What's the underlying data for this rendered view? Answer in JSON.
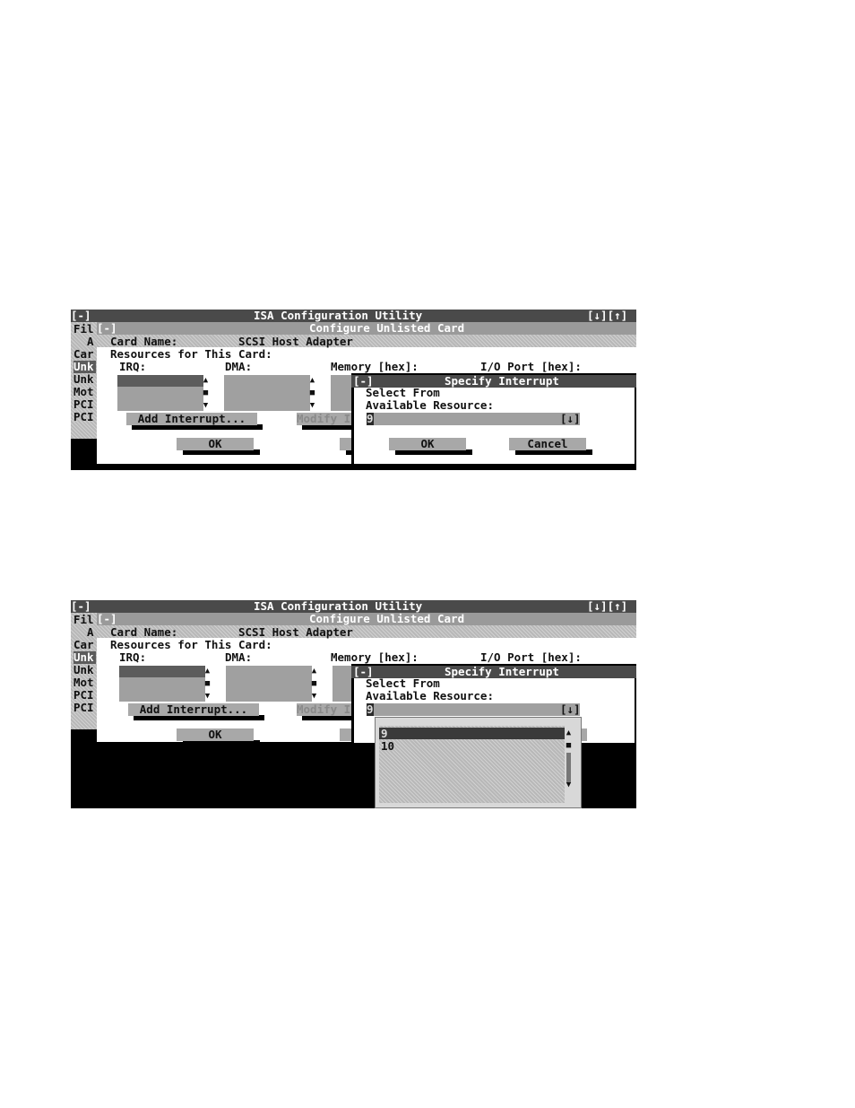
{
  "window": {
    "sys_menu": "[-]",
    "title": "ISA Configuration Utility",
    "controls": "[↓][↑]",
    "menu_stub": "Fil"
  },
  "side_list": {
    "items": [
      "A",
      "Car",
      "Unk",
      "Unk",
      "Mot",
      "PCI",
      "PCI"
    ],
    "selected_index": 2
  },
  "configure_dialog": {
    "sys_menu": "[-]",
    "title": "Configure Unlisted Card",
    "card_name_label": "Card Name:",
    "card_name_value": "SCSI Host Adapter",
    "resources_label": "Resources for This Card:",
    "irq_label": "IRQ:",
    "dma_label": "DMA:",
    "memory_label": "Memory [hex]:",
    "io_label": "I/O Port [hex]:",
    "add_interrupt_label": "Add Interrupt...",
    "modify_label": "Modify I",
    "ok_label": "OK"
  },
  "specify_dialog": {
    "sys_menu": "[-]",
    "title": "Specify Interrupt",
    "select_from": "Select From",
    "available_resource": "Available Resource:",
    "selected_value": "9",
    "dropdown_button": "[↓]",
    "ok_label": "OK",
    "cancel_label": "Cancel"
  },
  "dropdown_list": {
    "options": [
      "9",
      "10"
    ],
    "selected_index": 0
  },
  "scroll_glyphs": {
    "up": "▲",
    "thumb": "■",
    "down": "▼"
  },
  "colors": {
    "title_bar": "#4a4a4a",
    "dialog_bar": "#9a9a9a",
    "selection": "#5c5c5c",
    "background": "#000000"
  }
}
